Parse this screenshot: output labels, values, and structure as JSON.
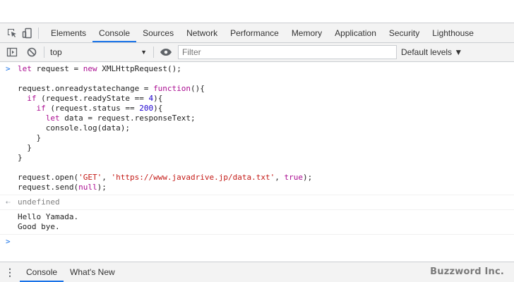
{
  "tabs": [
    {
      "label": "Elements",
      "active": false
    },
    {
      "label": "Console",
      "active": true
    },
    {
      "label": "Sources",
      "active": false
    },
    {
      "label": "Network",
      "active": false
    },
    {
      "label": "Performance",
      "active": false
    },
    {
      "label": "Memory",
      "active": false
    },
    {
      "label": "Application",
      "active": false
    },
    {
      "label": "Security",
      "active": false
    },
    {
      "label": "Lighthouse",
      "active": false
    }
  ],
  "toolbar": {
    "context": "top",
    "filter_placeholder": "Filter",
    "levels": "Default levels ▼"
  },
  "console": {
    "input_marker": ">",
    "code_lines": [
      "let request = new XMLHttpRequest();",
      "",
      "request.onreadystatechange = function(){",
      "  if (request.readyState == 4){",
      "    if (request.status == 200){",
      "      let data = request.responseText;",
      "      console.log(data);",
      "    }",
      "  }",
      "}",
      "",
      "request.open('GET', 'https://www.javadrive.jp/data.txt', true);",
      "request.send(null);"
    ],
    "result_marker": "⇠",
    "result": "undefined",
    "log_lines": [
      "Hello Yamada.",
      "Good bye."
    ],
    "prompt_marker": ">"
  },
  "drawer": {
    "tabs": [
      {
        "label": "Console",
        "active": true
      },
      {
        "label": "What's New",
        "active": false
      }
    ]
  },
  "watermark": "Buzzword Inc.",
  "colors": {
    "accent": "#1a73e8",
    "keyword": "#aa0d91",
    "number": "#1c00cf",
    "string": "#c41a16"
  }
}
